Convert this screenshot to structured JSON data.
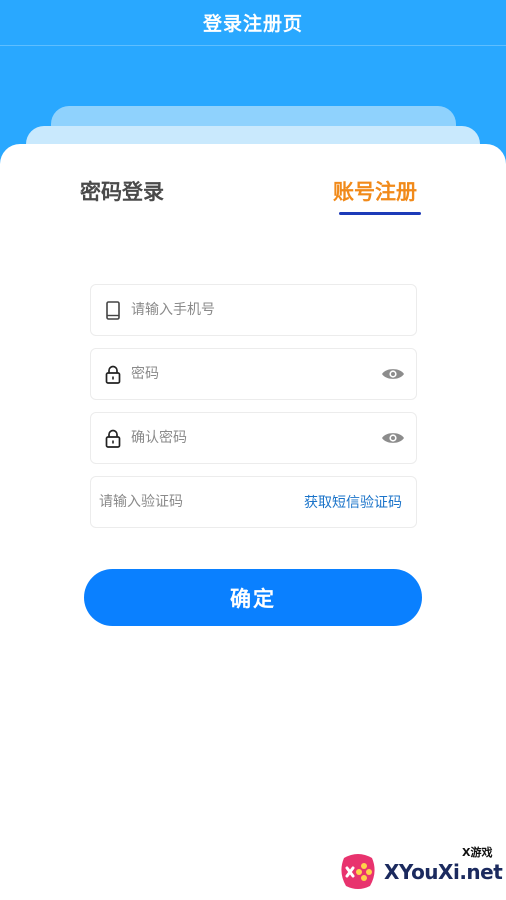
{
  "header": {
    "title": "登录注册页"
  },
  "tabs": [
    {
      "label": "密码登录",
      "active": false
    },
    {
      "label": "账号注册",
      "active": true
    }
  ],
  "form": {
    "phone": {
      "placeholder": "请输入手机号",
      "value": "",
      "icon": "phone-icon"
    },
    "password": {
      "placeholder": "密码",
      "value": "",
      "icon": "lock-icon"
    },
    "confirm_password": {
      "placeholder": "确认密码",
      "value": "",
      "icon": "lock-icon"
    },
    "code": {
      "placeholder": "请输入验证码",
      "value": "",
      "sms_label": "获取短信验证码"
    },
    "submit_label": "确定"
  },
  "watermark": {
    "small": "X游戏",
    "text": "XYouXi.net"
  },
  "colors": {
    "header_bg": "#29a8ff",
    "active_tab": "#f18a1a",
    "inactive_tab": "#4a4a4a",
    "underline": "#1d3bb8",
    "button": "#0a80ff",
    "link": "#1a73c9"
  }
}
